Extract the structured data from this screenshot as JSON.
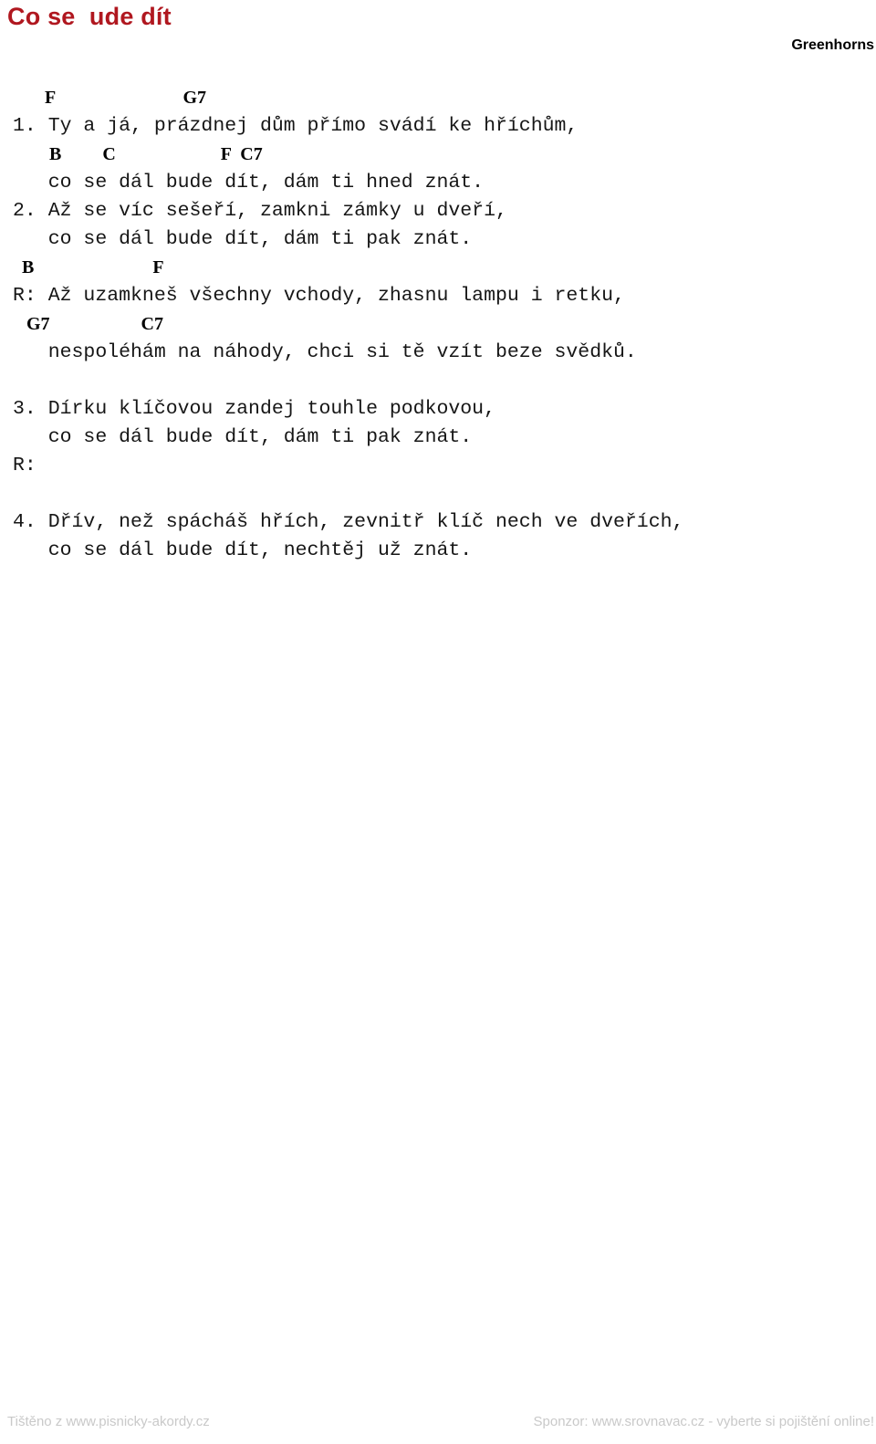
{
  "document": {
    "title": "Co se  ude dít",
    "artist": "Greenhorns"
  },
  "song": {
    "lines": [
      {
        "type": "chord",
        "text": "       F                            G7"
      },
      {
        "type": "lyric",
        "text": "1. Ty a já, prázdnej dům přímo svádí ke hříchům,"
      },
      {
        "type": "chord",
        "text": "        B         C                       F  C7"
      },
      {
        "type": "lyric",
        "text": "   co se dál bude dít, dám ti hned znát."
      },
      {
        "type": "lyric",
        "text": "2. Až se víc sešeří, zamkni zámky u dveří,"
      },
      {
        "type": "lyric",
        "text": "   co se dál bude dít, dám ti pak znát."
      },
      {
        "type": "chord",
        "text": "  B                          F"
      },
      {
        "type": "lyric",
        "text": "R: Až uzamkneš všechny vchody, zhasnu lampu i retku,"
      },
      {
        "type": "chord",
        "text": "   G7                    C7"
      },
      {
        "type": "lyric",
        "text": "   nespoléhám na náhody, chci si tě vzít beze svědků."
      },
      {
        "type": "spacer",
        "text": ""
      },
      {
        "type": "lyric",
        "text": "3. Dírku klíčovou zandej touhle podkovou,"
      },
      {
        "type": "lyric",
        "text": "   co se dál bude dít, dám ti pak znát."
      },
      {
        "type": "lyric",
        "text": "R:"
      },
      {
        "type": "spacer",
        "text": ""
      },
      {
        "type": "lyric",
        "text": "4. Dřív, než spácháš hřích, zevnitř klíč nech ve dveřích,"
      },
      {
        "type": "lyric",
        "text": "   co se dál bude dít, nechtěj už znát."
      }
    ]
  },
  "footer": {
    "left": "Tištěno z www.pisnicky-akordy.cz",
    "right": "Sponzor: www.srovnavac.cz - vyberte si pojištění online!"
  },
  "colors": {
    "title": "#b0171f",
    "text": "#161616",
    "footer": "#c9c9c9",
    "background": "#ffffff"
  }
}
